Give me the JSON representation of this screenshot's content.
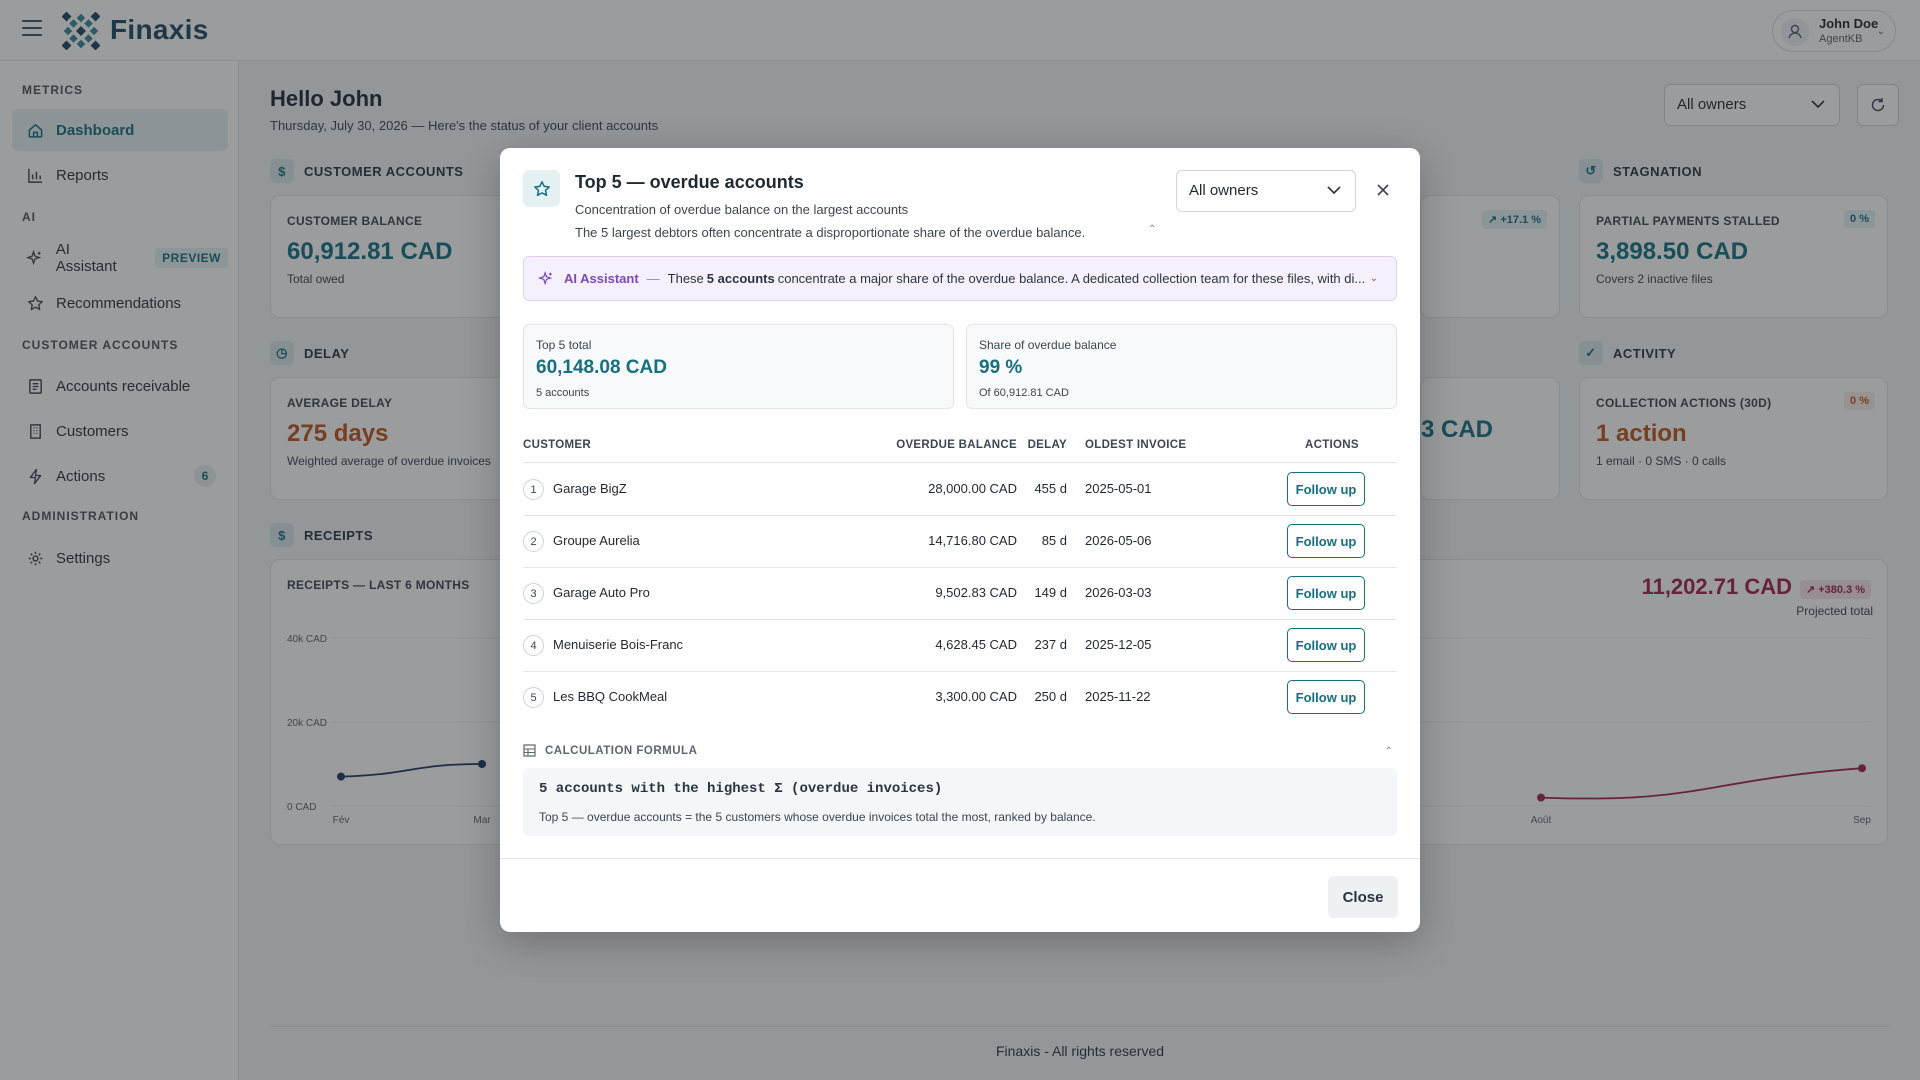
{
  "app": {
    "brand": "Finaxis"
  },
  "user": {
    "name": "John Doe",
    "role": "AgentKB"
  },
  "sidebar": {
    "sections": [
      {
        "label": "METRICS"
      },
      {
        "label": "AI"
      },
      {
        "label": "CUSTOMER ACCOUNTS"
      },
      {
        "label": "ADMINISTRATION"
      }
    ],
    "items": [
      {
        "label": "Dashboard",
        "icon": "home-icon"
      },
      {
        "label": "Reports",
        "icon": "bar-chart-icon"
      },
      {
        "label": "AI Assistant",
        "icon": "sparkles-icon",
        "badge": "PREVIEW"
      },
      {
        "label": "Recommendations",
        "icon": "star-icon"
      },
      {
        "label": "Accounts receivable",
        "icon": "receipt-icon"
      },
      {
        "label": "Customers",
        "icon": "building-icon"
      },
      {
        "label": "Actions",
        "icon": "bolt-icon",
        "count": "6"
      },
      {
        "label": "Settings",
        "icon": "gear-icon"
      }
    ]
  },
  "page": {
    "greeting": "Hello John",
    "subtitle": "Thursday, July 30, 2026 — Here's the status of your client accounts",
    "owner_filter": "All owners"
  },
  "sections": {
    "customer_accounts": "CUSTOMER ACCOUNTS",
    "stagnation": "STAGNATION",
    "delay": "DELAY",
    "activity": "ACTIVITY",
    "receipts": "RECEIPTS"
  },
  "cards": {
    "customer_balance": {
      "label": "CUSTOMER BALANCE",
      "value": "60,912.81 CAD",
      "sub": "Total owed"
    },
    "partial_payments": {
      "label": "PARTIAL PAYMENTS STALLED",
      "value": "3,898.50 CAD",
      "sub": "Covers 2 inactive files",
      "pill": "0 %"
    },
    "hidden_pill": "↗ +17.1 %",
    "average_delay": {
      "label": "AVERAGE DELAY",
      "value": "275 days",
      "sub": "Weighted average of overdue invoices"
    },
    "hidden_value": "3 CAD",
    "collection_actions": {
      "label": "COLLECTION ACTIONS (30D)",
      "value": "1 action",
      "sub": "1 email · 0 SMS · 0 calls",
      "pill": "0 %"
    },
    "receipts": {
      "label": "RECEIPTS — LAST 6 MONTHS",
      "projected_value": "11,202.71 CAD",
      "projected_pill": "↗ +380.3 %",
      "projected_label": "Projected total"
    }
  },
  "chart_data": {
    "type": "line",
    "title": "RECEIPTS — LAST 6 MONTHS",
    "y_ticks": [
      "40k CAD",
      "20k CAD",
      "0 CAD"
    ],
    "x_ticks_visible": [
      "Fév",
      "Mar",
      "Août",
      "Sep"
    ],
    "ylim": [
      0,
      40000
    ],
    "grid": true,
    "series": [
      {
        "name": "Receipts",
        "color": "#1e3a5f",
        "points": [
          {
            "x": "Fév",
            "y": 7000
          },
          {
            "x": "Mar",
            "y": 10000
          }
        ]
      },
      {
        "name": "Projected",
        "color": "#a2234a",
        "points": [
          {
            "x": "Août",
            "y": 2000
          },
          {
            "x": "Sep",
            "y": 9000
          }
        ]
      }
    ]
  },
  "modal": {
    "title": "Top 5 — overdue accounts",
    "subtitle": "Concentration of overdue balance on the largest accounts",
    "description": "The 5 largest debtors often concentrate a disproportionate share of the overdue balance.",
    "owner_filter": "All owners",
    "ai": {
      "label": "AI Assistant",
      "dash": "—",
      "text_before": "These",
      "text_strong": "5 accounts",
      "text_after": "concentrate a major share of the overdue balance. A dedicated collection team for these files, with di..."
    },
    "stats": [
      {
        "label": "Top 5 total",
        "value": "60,148.08 CAD",
        "sub": "5 accounts"
      },
      {
        "label": "Share of overdue balance",
        "value": "99 %",
        "sub": "Of 60,912.81 CAD"
      }
    ],
    "columns": {
      "customer": "CUSTOMER",
      "balance": "OVERDUE BALANCE",
      "delay": "DELAY",
      "oldest": "OLDEST INVOICE",
      "actions": "ACTIONS"
    },
    "rows": [
      {
        "rank": "1",
        "customer": "Garage BigZ",
        "balance": "28,000.00 CAD",
        "delay": "455 d",
        "oldest": "2025-05-01",
        "action": "Follow up"
      },
      {
        "rank": "2",
        "customer": "Groupe Aurelia",
        "balance": "14,716.80 CAD",
        "delay": "85 d",
        "oldest": "2026-05-06",
        "action": "Follow up"
      },
      {
        "rank": "3",
        "customer": "Garage Auto Pro",
        "balance": "9,502.83 CAD",
        "delay": "149 d",
        "oldest": "2026-03-03",
        "action": "Follow up"
      },
      {
        "rank": "4",
        "customer": "Menuiserie Bois-Franc",
        "balance": "4,628.45 CAD",
        "delay": "237 d",
        "oldest": "2025-12-05",
        "action": "Follow up"
      },
      {
        "rank": "5",
        "customer": "Les BBQ CookMeal",
        "balance": "3,300.00 CAD",
        "delay": "250 d",
        "oldest": "2025-11-22",
        "action": "Follow up"
      }
    ],
    "formula": {
      "label": "CALCULATION FORMULA",
      "code": "5 accounts with the highest Σ (overdue invoices)",
      "description": "Top 5 — overdue accounts = the 5 customers whose overdue invoices total the most, ranked by balance."
    },
    "close_label": "Close"
  },
  "footer": "Finaxis - All rights reserved"
}
